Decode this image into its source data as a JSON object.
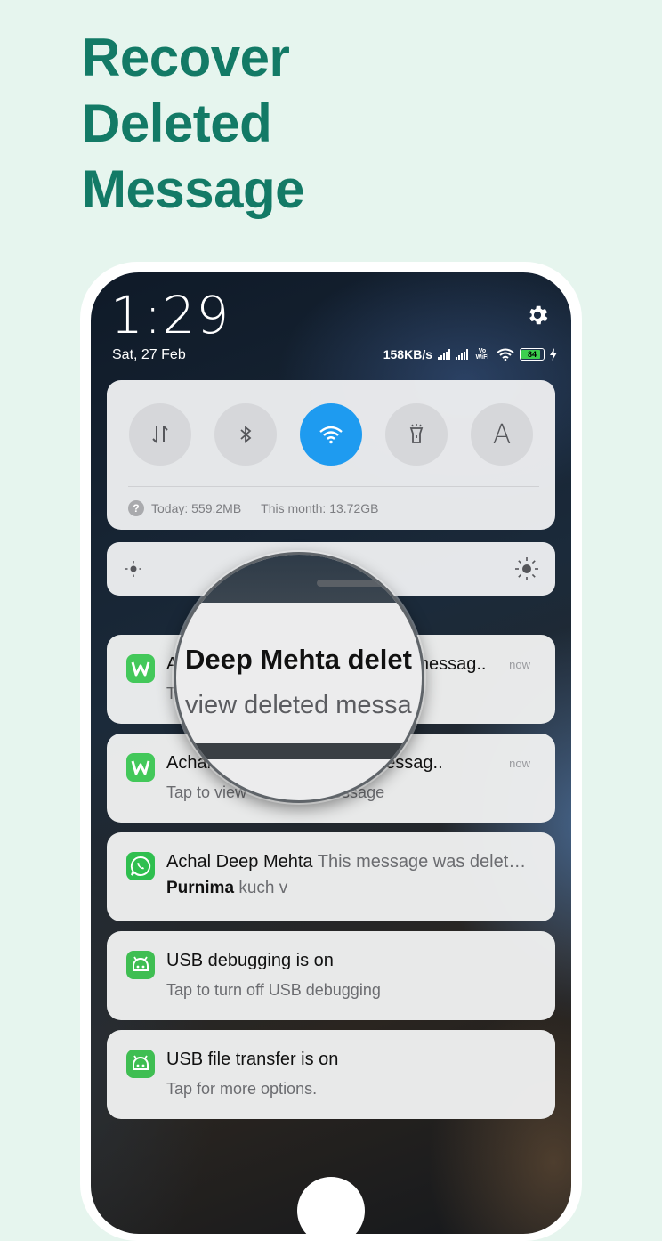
{
  "headline": [
    "Recover",
    "Deleted",
    "Message"
  ],
  "status_bar": {
    "time": "1:29",
    "date": "Sat, 27 Feb",
    "network_speed": "158KB/s",
    "volte": "Vo WiFi",
    "battery": "84"
  },
  "quick_settings": {
    "toggles": [
      {
        "icon": "mobile-data-icon",
        "on": false
      },
      {
        "icon": "bluetooth-icon",
        "on": false
      },
      {
        "icon": "wifi-icon",
        "on": true
      },
      {
        "icon": "flashlight-icon",
        "on": false
      },
      {
        "icon": "auto-brightness-icon",
        "on": false,
        "label": "A"
      }
    ],
    "usage_today": "Today: 559.2MB",
    "usage_month": "This month: 13.72GB"
  },
  "notifications": [
    {
      "app": "deleted-message-app",
      "title_left": "A",
      "title_right": "messag..",
      "body": "T",
      "time": "now"
    },
    {
      "app": "deleted-message-app",
      "title_left": "Achal",
      "title_right": "ed a messag..",
      "body_left": "Tap to view",
      "body_right": "message",
      "time": "now"
    },
    {
      "app": "whatsapp",
      "title": "Achal Deep Mehta",
      "title_sub": "This message was delet…",
      "line2": "Purnima",
      "line2_sub": "kuch v"
    },
    {
      "app": "android",
      "title": "USB debugging is on",
      "body": "Tap to turn off USB debugging"
    },
    {
      "app": "android",
      "title": "USB file transfer is on",
      "body": "Tap for more options."
    }
  ],
  "magnifier": {
    "title": "Deep Mehta delet",
    "body": "view deleted messa"
  },
  "colors": {
    "headline": "#137a66",
    "background": "#e6f5ee",
    "wifi_on": "#1e9bf0",
    "app_green": "#43c85a"
  }
}
